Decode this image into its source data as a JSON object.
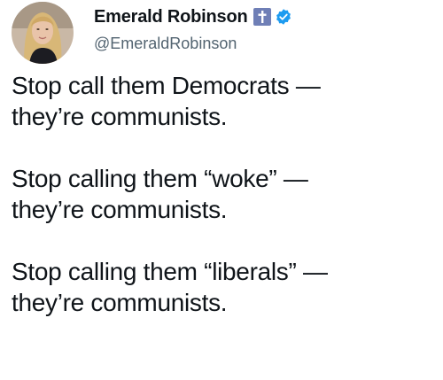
{
  "author": {
    "display_name": "Emerald Robinson",
    "handle": "@EmeraldRobinson",
    "badges": [
      "cross-icon",
      "verified-badge-icon"
    ]
  },
  "colors": {
    "verified_blue": "#1d9bf0",
    "cross_badge": "#6f7fb6",
    "handle_gray": "#536471",
    "text": "#0f1419"
  },
  "tweet": {
    "paragraphs": [
      {
        "line1": "Stop call them Democrats —",
        "line2": "they’re communists."
      },
      {
        "line1": "Stop calling them “woke” —",
        "line2": "they’re communists."
      },
      {
        "line1": "Stop calling them “liberals” —",
        "line2": "they’re communists."
      }
    ]
  }
}
